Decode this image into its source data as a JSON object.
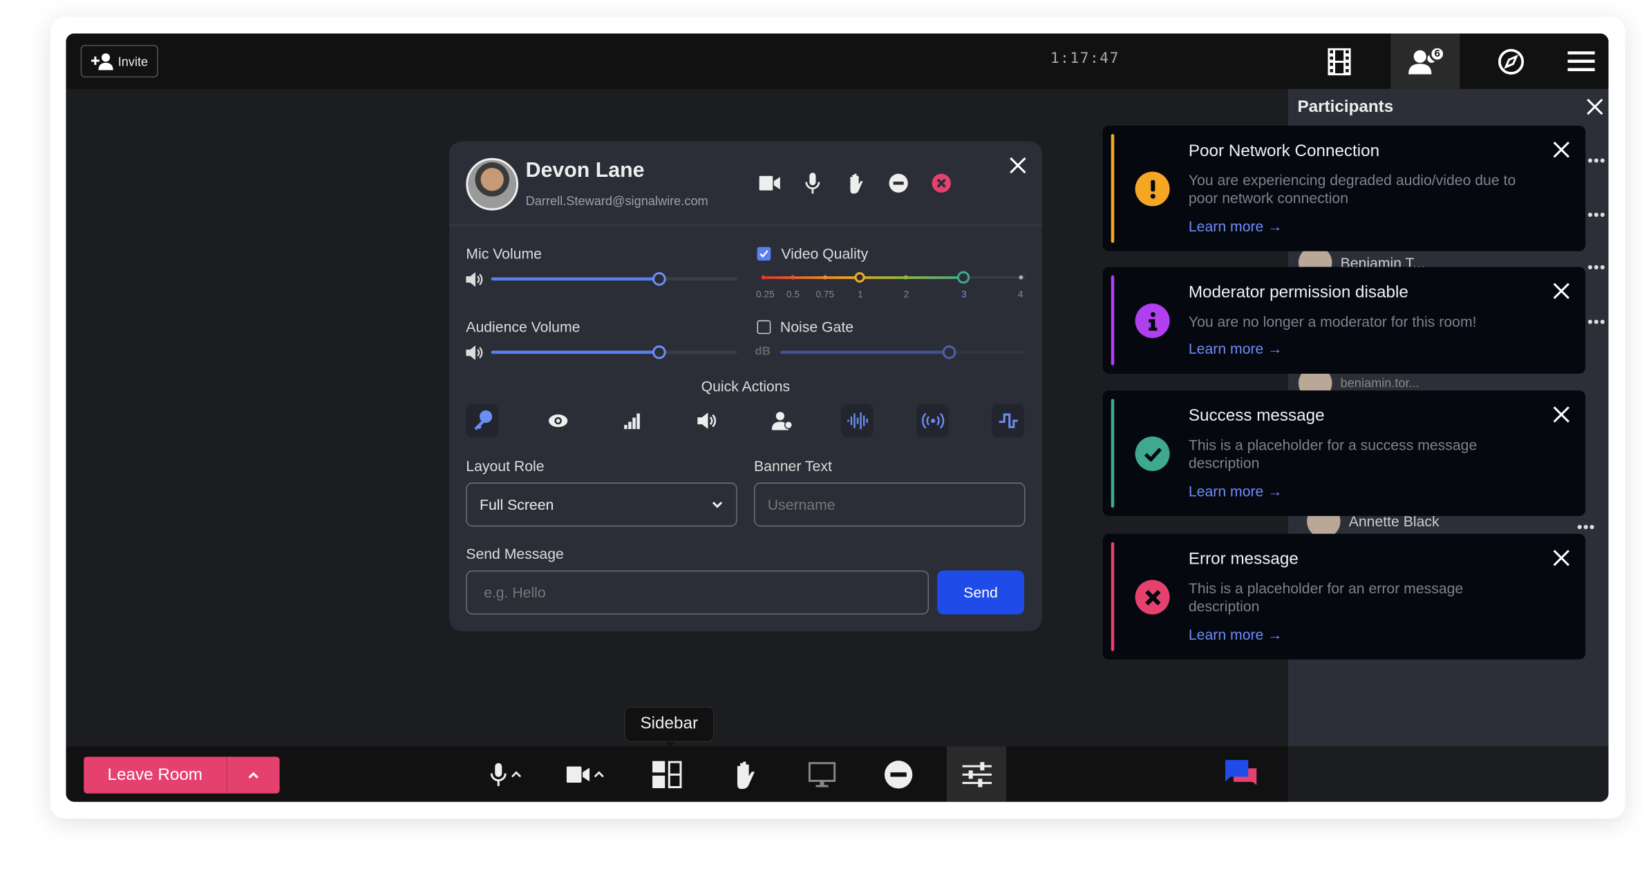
{
  "topbar": {
    "invite_label": "Invite",
    "timer": "1:17:47",
    "participant_count": "6",
    "icons": [
      "film-icon",
      "participants-icon",
      "compass-icon",
      "menu-icon"
    ]
  },
  "participants": {
    "title": "Participants",
    "rows": [
      {
        "name": "Beniamin T..."
      },
      {
        "name": "beniamin.tor..."
      },
      {
        "name": "Annette Black"
      }
    ]
  },
  "modal": {
    "name": "Devon Lane",
    "email": "Darrell.Steward@signalwire.com",
    "header_icons": [
      "video-icon",
      "mic-icon",
      "hand-icon",
      "minus-circle-icon",
      "remove-icon"
    ],
    "mic_volume": {
      "label": "Mic Volume",
      "value_percent": 68
    },
    "audience_volume": {
      "label": "Audience Volume",
      "value_percent": 68
    },
    "video_quality": {
      "label": "Video Quality",
      "checked": true,
      "ticks": [
        "0.25",
        "0.5",
        "0.75",
        "1",
        "2",
        "3",
        "4"
      ],
      "low": "1",
      "selected": "3"
    },
    "noise_gate": {
      "label": "Noise Gate",
      "checked": false,
      "unit": "dB",
      "value_percent": 69
    },
    "quick_actions": {
      "label": "Quick Actions",
      "icons": [
        "key-icon",
        "eye-icon",
        "signal-bars-icon",
        "speaker-icon",
        "user-icon",
        "waveform-icon",
        "broadcast-icon",
        "pulse-icon"
      ]
    },
    "layout_role": {
      "label": "Layout Role",
      "value": "Full Screen"
    },
    "banner_text": {
      "label": "Banner Text",
      "placeholder": "Username"
    },
    "send_message": {
      "label": "Send Message",
      "placeholder": "e.g. Hello",
      "button": "Send"
    }
  },
  "toasts": [
    {
      "type": "warning",
      "color": "#f5a623",
      "title": "Poor Network Connection",
      "description": "You are experiencing degraded audio/video due to poor network connection",
      "link": "Learn more →"
    },
    {
      "type": "info",
      "color": "#b03ff0",
      "title": "Moderator permission disable",
      "description": "You are no longer a moderator for this room!",
      "link": "Learn more →"
    },
    {
      "type": "success",
      "color": "#3fa98f",
      "title": "Success message",
      "description": "This is a placeholder for a success message description",
      "link": "Learn more →"
    },
    {
      "type": "error",
      "color": "#e5416f",
      "title": "Error message",
      "description": "This is a placeholder for an error message description",
      "link": "Learn more →"
    }
  ],
  "bottombar": {
    "leave_label": "Leave Room",
    "tooltip": "Sidebar",
    "icons": [
      "mic-icon",
      "video-icon",
      "sidebar-layout-icon",
      "hand-icon",
      "screen-share-icon",
      "minus-circle-icon",
      "settings-sliders-icon",
      "chat-icon"
    ]
  },
  "colors": {
    "accent": "#1f4ce8",
    "leave": "#e5416f",
    "slider": "#5b7ff0"
  }
}
